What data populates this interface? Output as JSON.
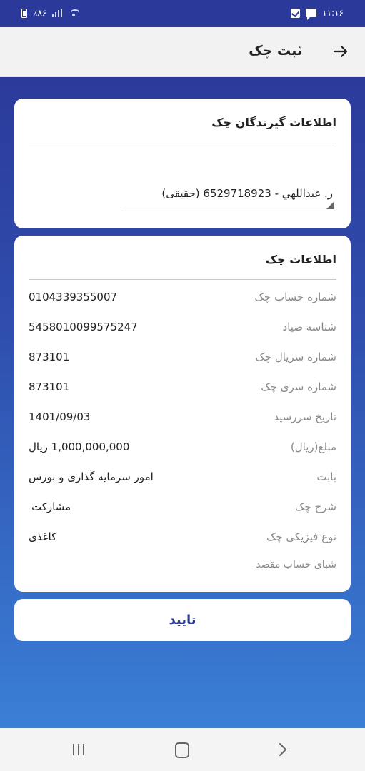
{
  "status_bar": {
    "battery": "٪۸۶",
    "time": "۱۱:۱۶"
  },
  "app_bar": {
    "title": "ثبت چک"
  },
  "receivers_card": {
    "title": "اطلاعات گیرندگان چک",
    "selected_receiver": "ر. عبداللهي - 6529718923 (حقیقی)"
  },
  "cheque_card": {
    "title": "اطلاعات چک",
    "rows": [
      {
        "label": "شماره حساب چک",
        "value": "0104339355007"
      },
      {
        "label": "شناسه صیاد",
        "value": "5458010099575247"
      },
      {
        "label": "شماره سریال چک",
        "value": "873101"
      },
      {
        "label": "شماره سری چک",
        "value": "873101"
      },
      {
        "label": "تاریخ سررسید",
        "value": "1401/09/03"
      },
      {
        "label": "مبلغ(ریال)",
        "value": "1,000,000,000 ریال"
      },
      {
        "label": "بابت",
        "value": "امور سرمایه گذاری و بورس"
      },
      {
        "label": "شرح چک",
        "value": "مشارکت"
      },
      {
        "label": "نوع فیزیکی چک",
        "value": "کاغذی"
      },
      {
        "label": "شبای حساب مقصد",
        "value": ""
      }
    ]
  },
  "confirm_button": {
    "label": "تایید"
  },
  "nav_bar": {
    "recents_icon": "recents-icon",
    "home_icon": "home-icon",
    "back_icon": "chevron-right-icon"
  },
  "colors": {
    "primary": "#2b3a9a",
    "gradient_bottom": "#3a7fd6"
  }
}
